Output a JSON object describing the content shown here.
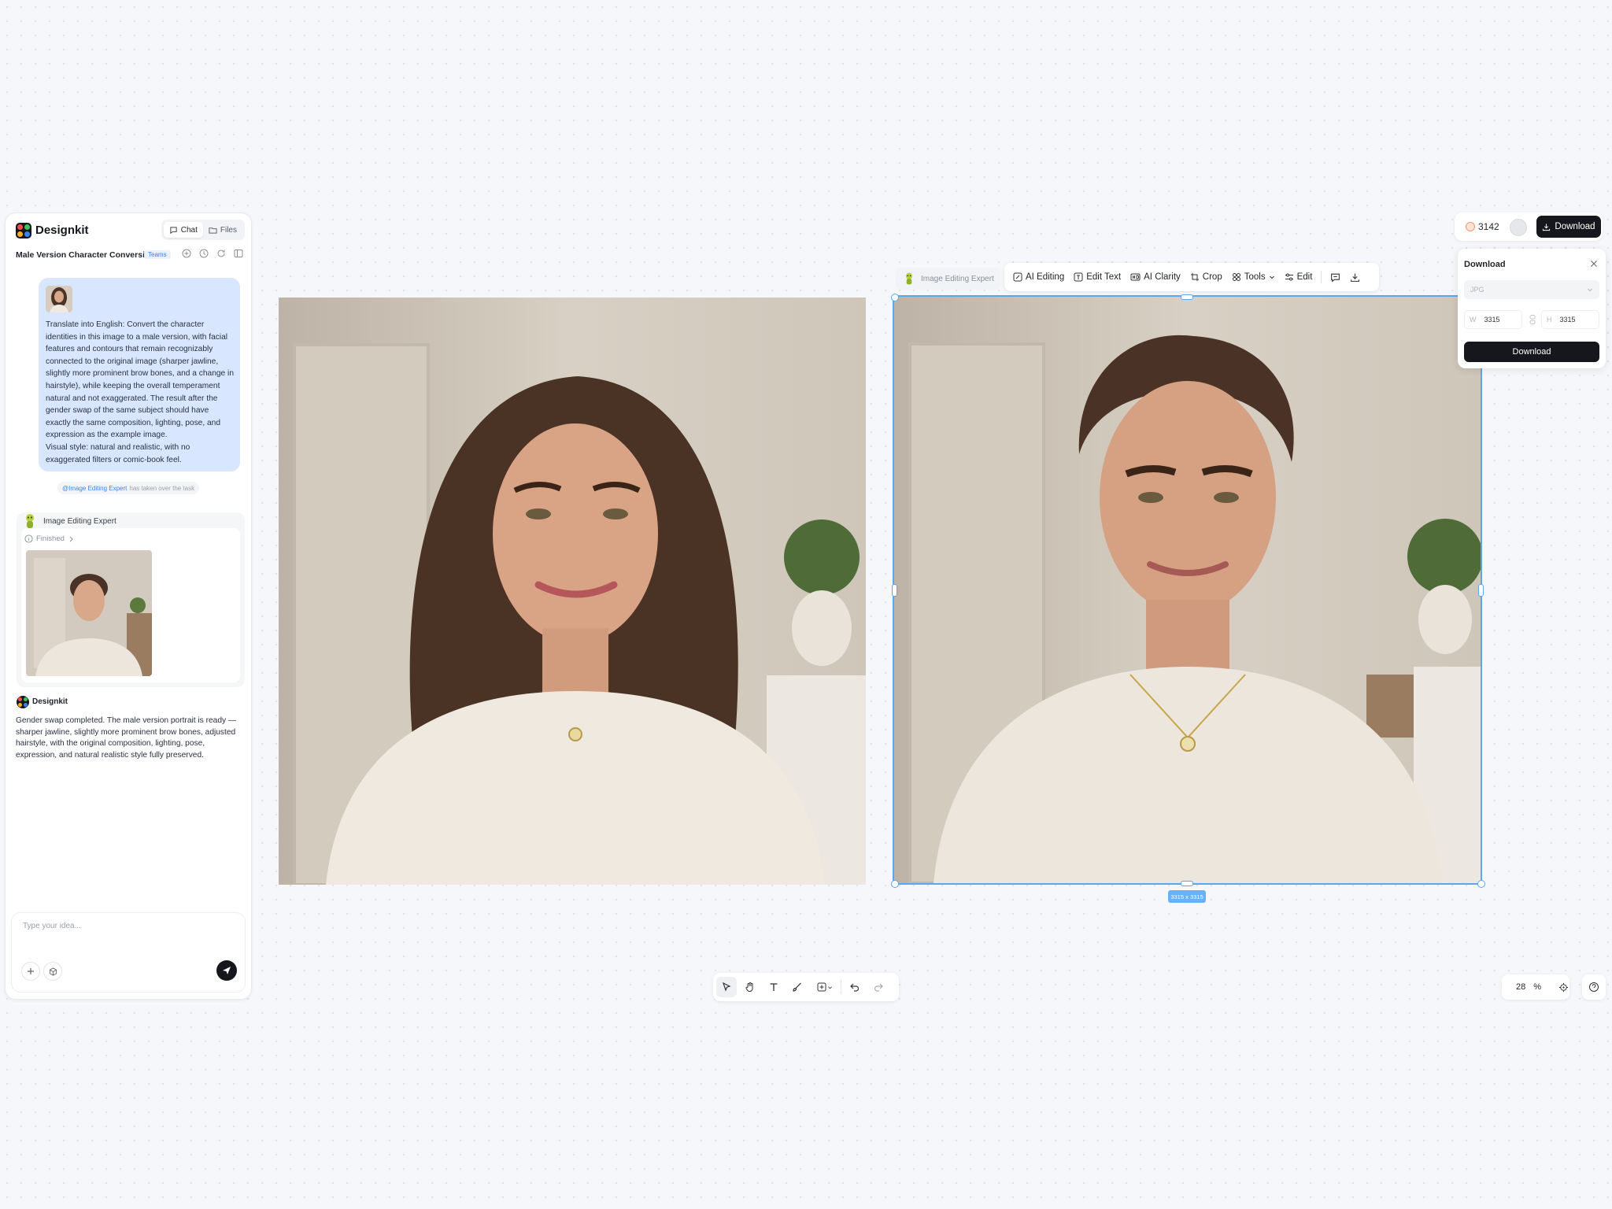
{
  "app": {
    "name": "Designkit"
  },
  "header": {
    "tabs": [
      {
        "label": "Chat"
      },
      {
        "label": "Files"
      }
    ],
    "project_title": "Male Version Character Conversion",
    "badge": "Teams"
  },
  "conversation": {
    "user_message": "Translate into English: Convert the character identities in this image to a male version, with facial features and contours that remain recognizably connected to the original image (sharper jawline, slightly more prominent brow bones, and a change in hairstyle), while keeping the overall temperament natural and not exaggerated. The result after the gender swap of the same subject should have exactly the same composition, lighting, pose, and expression as the example image.\nVisual style: natural and realistic, with no exaggerated filters or comic-book feel.",
    "handover_mention": "@Image Editing Expert",
    "handover_text": "has taken over the task",
    "expert_name": "Image Editing Expert",
    "status": "Finished",
    "assistant_name": "Designkit",
    "assistant_message": "Gender swap completed. The male version portrait is ready — sharper jawline, slightly more prominent brow bones, adjusted hairstyle, with the original composition, lighting, pose, expression, and natural realistic style fully preserved."
  },
  "composer": {
    "placeholder": "Type your idea..."
  },
  "canvas": {
    "selected_dimensions": "3315 x 3315",
    "expert_tag": "Image Editing Expert"
  },
  "image_toolbar": {
    "ai_editing": "AI Editing",
    "edit_text": "Edit Text",
    "ai_clarity": "AI Clarity",
    "crop": "Crop",
    "tools": "Tools",
    "edit": "Edit"
  },
  "topbar": {
    "credits": "3142",
    "download_label": "Download"
  },
  "download_panel": {
    "title": "Download",
    "format": "JPG",
    "width_label": "W",
    "width": "3315",
    "height_label": "H",
    "height": "3315",
    "button": "Download"
  },
  "zoom": {
    "value": "28",
    "unit": "%"
  },
  "colors": {
    "accent": "#3b82f6",
    "user_bubble": "#d8e7ff",
    "selection": "#5aa7f0",
    "dark_button": "#15171c"
  }
}
